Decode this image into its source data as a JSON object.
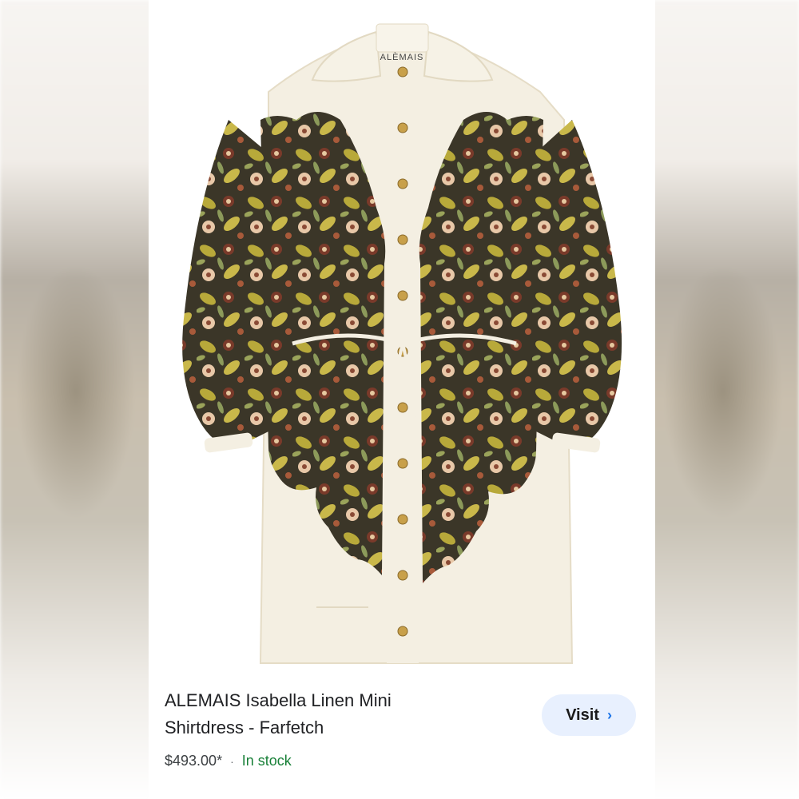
{
  "product": {
    "title_line1": "ALEMAIS Isabella Linen Mini",
    "title_line2": "Shirtdress - Farfetch",
    "price": "$493.00*",
    "separator": "·",
    "availability": "In stock",
    "label_text": "ALÈMAIS"
  },
  "actions": {
    "visit_label": "Visit",
    "visit_icon": "›"
  },
  "colors": {
    "stock_green": "#188038",
    "visit_bg": "#e8f0fe",
    "chevron_blue": "#1a73e8",
    "dress_cream": "#f4efe2",
    "print_dark": "#3b3628",
    "print_olive": "#b8a93a"
  }
}
